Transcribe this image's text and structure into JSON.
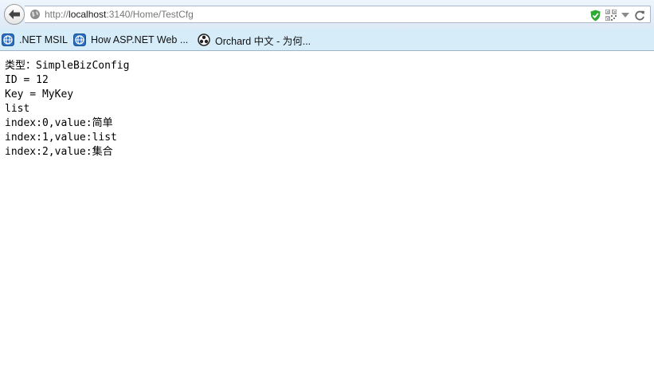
{
  "browser": {
    "url_prefix": "http://",
    "url_host": "localhost",
    "url_rest": ":3140/Home/TestCfg"
  },
  "bookmarks": [
    {
      "label": ".NET MSIL",
      "icon": "globe-bookmark-icon"
    },
    {
      "label": "How ASP.NET Web ...",
      "icon": "globe-bookmark-icon"
    },
    {
      "label": "Orchard 中文 - 为何...",
      "icon": "orchard-icon"
    }
  ],
  "content": {
    "lines": [
      "类型：SimpleBizConfig",
      "ID = 12",
      "Key = MyKey",
      "list",
      "index:0,value:简单",
      "index:1,value:list",
      "index:2,value:集合"
    ]
  },
  "colors": {
    "toolbar_bg": "#dde9f6",
    "bookmarks_bg": "#d6ecf9",
    "shield_green": "#2fa836",
    "bookmark_icon_blue": "#2b6fc0"
  }
}
